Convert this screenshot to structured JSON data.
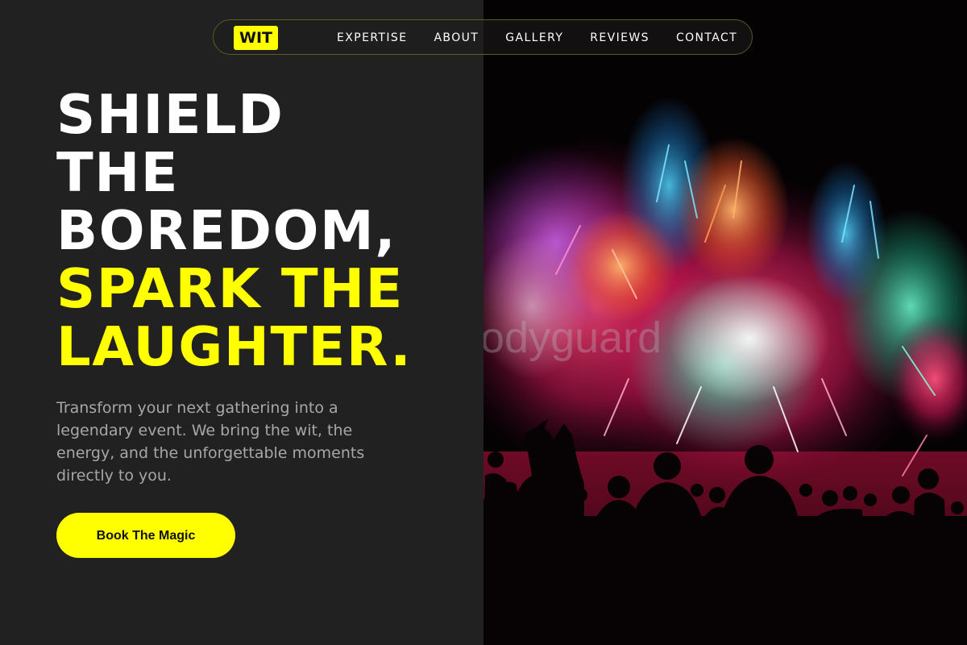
{
  "brand": {
    "logo_text": "WIT",
    "accent_color": "#ffff00"
  },
  "nav": {
    "links": [
      {
        "label": "EXPERTISE"
      },
      {
        "label": "ABOUT"
      },
      {
        "label": "GALLERY"
      },
      {
        "label": "REVIEWS"
      },
      {
        "label": "CONTACT"
      }
    ]
  },
  "hero": {
    "headline_white": [
      "SHIELD",
      "THE",
      "BOREDOM,"
    ],
    "headline_yellow": [
      "SPARK THE",
      "LAUGHTER."
    ],
    "subtitle": "Transform your next gathering into a legendary event. We bring the wit, the energy, and the unforgettable moments directly to you.",
    "cta_label": "Book The Magic"
  },
  "image": {
    "description_icon": "fireworks-crowd-photo",
    "watermark_text": "odyguard"
  }
}
